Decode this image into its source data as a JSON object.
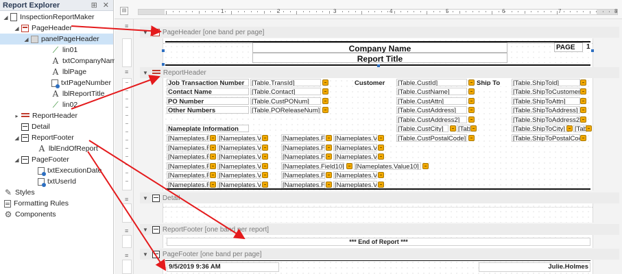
{
  "explorer": {
    "title": "Report Explorer",
    "pin_glyph": "⊞",
    "close_glyph": "✕",
    "items": [
      {
        "label": "InspectionReportMaker",
        "icon": "report-icon",
        "toggle": "◢"
      },
      {
        "label": "PageHeader",
        "icon": "page-header-band-icon",
        "toggle": "◢"
      },
      {
        "label": "panelPageHeader",
        "icon": "panel-icon",
        "toggle": "◢"
      },
      {
        "label": "lin01",
        "icon": "line-icon"
      },
      {
        "label": "txtCompanyName",
        "icon": "label-icon",
        "glyph": "A"
      },
      {
        "label": "lblPage",
        "icon": "label-icon",
        "glyph": "A"
      },
      {
        "label": "txtPageNumber",
        "icon": "field-icon"
      },
      {
        "label": "lblReportTitle",
        "icon": "label-icon",
        "glyph": "A"
      },
      {
        "label": "lin02",
        "icon": "line-icon"
      },
      {
        "label": "ReportHeader",
        "icon": "report-header-band-icon",
        "toggle": "▸"
      },
      {
        "label": "Detail",
        "icon": "detail-band-icon"
      },
      {
        "label": "ReportFooter",
        "icon": "report-footer-band-icon",
        "toggle": "◢"
      },
      {
        "label": "lblEndOfReport",
        "icon": "label-icon",
        "glyph": "A"
      },
      {
        "label": "PageFooter",
        "icon": "page-footer-band-icon",
        "toggle": "◢"
      },
      {
        "label": "txtExecutionDate",
        "icon": "field-icon"
      },
      {
        "label": "txtUserId",
        "icon": "field-icon"
      },
      {
        "label": "Styles",
        "icon": "styles-icon"
      },
      {
        "label": "Formatting Rules",
        "icon": "formatting-rules-icon"
      },
      {
        "label": "Components",
        "icon": "components-icon"
      }
    ]
  },
  "ruler": {
    "corner_glyph": "▤",
    "numbers": [
      "1",
      "2",
      "3",
      "4",
      "5",
      "6",
      "7",
      "8"
    ]
  },
  "bands": {
    "page_header": {
      "title": "PageHeader [one band per page]"
    },
    "report_header": {
      "title": "ReportHeader"
    },
    "detail": {
      "title": "Detail"
    },
    "report_footer": {
      "title": "ReportFooter [one band per report]"
    },
    "page_footer": {
      "title": "PageFooter [one band per page]"
    }
  },
  "page_header": {
    "company_name": "Company Name",
    "report_title": "Report Title",
    "page_label": "PAGE",
    "page_number": "1"
  },
  "report_header": {
    "labels": {
      "job_transaction_number": "Job Transaction Number",
      "contact_name": "Contact Name",
      "po_number": "PO Number",
      "other_numbers": "Other Numbers",
      "customer": "Customer",
      "ship_to": "Ship To",
      "nameplate_information": "Nameplate Information"
    },
    "fields": {
      "trans_id": "[Table.TransId]",
      "contact": "[Table.Contact]",
      "cust_po_num": "[Table.CustPONum]",
      "po_release_num": "[Table.POReleaseNum]",
      "cust_id": "[Table.CustId]",
      "cust_name": "[Table.CustName]",
      "cust_attn": "[Table.CustAttn]",
      "cust_address": "[Table.CustAddress]",
      "cust_address2": "[Table.CustAddress2]",
      "cust_city": "[Table.CustCity]",
      "cust_state": "[Tab",
      "cust_postal_code": "[Table.CustPostalCode]",
      "ship_told": "[Table.ShipTold]",
      "ship_to_customer": "[Table.ShipToCustomer",
      "ship_to_attn": "[Table.ShipToAttn]",
      "ship_to_address": "[Table.ShipToAddress]",
      "ship_to_address2": "[Table.ShipToAddress2]",
      "ship_to_city": "[Table.ShipToCity]",
      "ship_to_state": "[Tab",
      "ship_to_postal_code": "[Table.ShipToPostalCod"
    },
    "nameplate_rows": [
      [
        "[Nameplates.F",
        "[Nameplates.V",
        "[Nameplates.F",
        "[Nameplates.V"
      ],
      [
        "[Nameplates.F",
        "[Nameplates.V",
        "[Nameplates.F",
        "[Nameplates.V"
      ],
      [
        "[Nameplates.F",
        "[Nameplates.V",
        "[Nameplates.F",
        "[Nameplates.V"
      ],
      [
        "[Nameplates.F",
        "[Nameplates.V",
        "[Nameplates.Field10]",
        "[Nameplates.Value10]"
      ],
      [
        "[Nameplates.F",
        "[Nameplates.V",
        "[Nameplates.F",
        "[Nameplates.V"
      ],
      [
        "[Nameplates.F",
        "[Nameplates.V",
        "[Nameplates.F",
        "[Nameplates.V"
      ]
    ]
  },
  "report_footer": {
    "end_of_report": "*** End of Report ***"
  },
  "page_footer": {
    "execution_date": "9/5/2019 9:36 AM",
    "user_id": "Julie.Holmes"
  },
  "colors": {
    "arrow": "#e41a1c",
    "band_header": "#ececec",
    "tree_selection": "#cde3f7",
    "tag": "#f2a900"
  }
}
